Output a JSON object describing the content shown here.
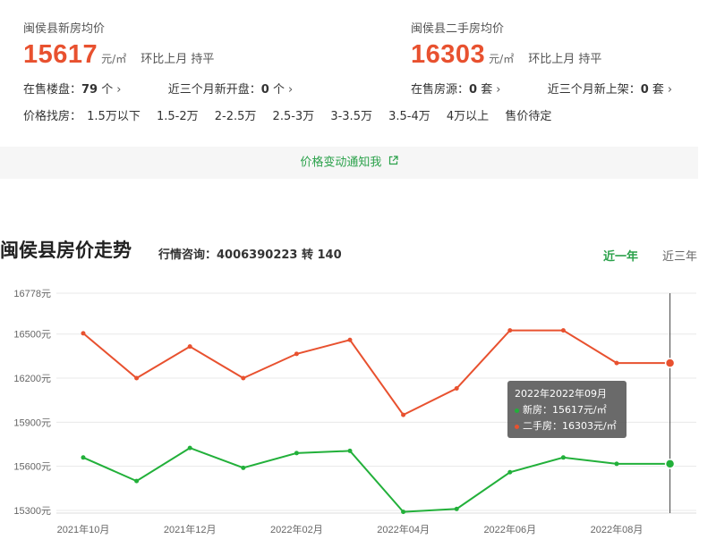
{
  "new_house": {
    "label": "闽侯县新房均价",
    "price": "15617",
    "unit": "元/㎡",
    "change": "环比上月 持平",
    "stat1_label": "在售楼盘：",
    "stat1_value": "79",
    "stat1_suffix": "个",
    "stat2_label": "近三个月新开盘：",
    "stat2_value": "0",
    "stat2_suffix": "个"
  },
  "second_hand": {
    "label": "闽侯县二手房均价",
    "price": "16303",
    "unit": "元/㎡",
    "change": "环比上月 持平",
    "stat1_label": "在售房源：",
    "stat1_value": "0",
    "stat1_suffix": "套",
    "stat2_label": "近三个月新上架：",
    "stat2_value": "0",
    "stat2_suffix": "套"
  },
  "price_filter": {
    "label": "价格找房：",
    "options": [
      "1.5万以下",
      "1.5-2万",
      "2-2.5万",
      "2.5-3万",
      "3-3.5万",
      "3.5-4万",
      "4万以上",
      "售价待定"
    ]
  },
  "notify": {
    "label": "价格变动通知我"
  },
  "trend": {
    "title": "闽侯县房价走势",
    "hotline": "行情咨询：4006390223 转 140",
    "tab_year": "近一年",
    "tab_three": "近三年"
  },
  "tooltip": {
    "title": "2022年2022年09月",
    "new_line": "新房：15617元/㎡",
    "second_line": "二手房：16303元/㎡"
  },
  "colors": {
    "accent": "#e8512f",
    "green": "#2aa14a"
  },
  "chart_data": {
    "type": "line",
    "x": [
      "2021年10月",
      "2021年11月",
      "2021年12月",
      "2022年01月",
      "2022年02月",
      "2022年03月",
      "2022年04月",
      "2022年05月",
      "2022年06月",
      "2022年07月",
      "2022年08月",
      "2022年09月"
    ],
    "x_tick_labels": [
      "2021年10月",
      "2021年12月",
      "2022年02月",
      "2022年04月",
      "2022年06月",
      "2022年08月"
    ],
    "y_ticks": [
      15300,
      15600,
      15900,
      16200,
      16500,
      16778
    ],
    "y_tick_suffix": "元",
    "ylim": [
      15300,
      16778
    ],
    "series": [
      {
        "name": "新房",
        "color": "#22b03a",
        "values": [
          15660,
          15500,
          15725,
          15590,
          15690,
          15705,
          15290,
          15310,
          15560,
          15660,
          15617,
          15617
        ]
      },
      {
        "name": "二手房",
        "color": "#e8512f",
        "values": [
          16505,
          16200,
          16415,
          16200,
          16365,
          16460,
          15950,
          16130,
          16525,
          16525,
          16303,
          16303
        ]
      }
    ],
    "highlight_index": 11
  }
}
